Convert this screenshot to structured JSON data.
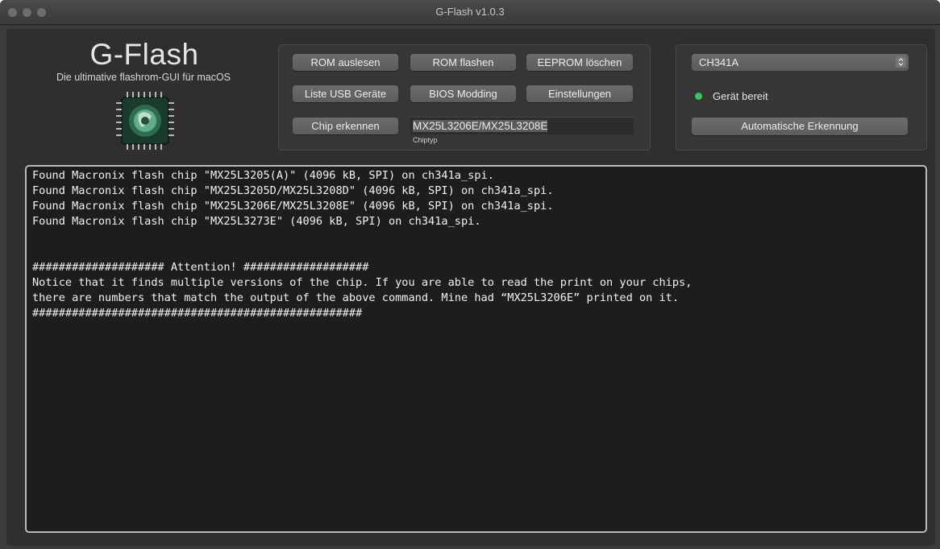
{
  "window": {
    "title": "G-Flash v1.0.3"
  },
  "brand": {
    "name": "G-Flash",
    "subtitle": "Die ultimative flashrom-GUI für macOS",
    "logo_icon": "chip-logo-icon"
  },
  "actions": {
    "read_rom": "ROM auslesen",
    "flash_rom": "ROM flashen",
    "erase_eeprom": "EEPROM löschen",
    "usb_list": "Liste USB Geräte",
    "bios_modding": "BIOS Modding",
    "settings": "Einstellungen",
    "detect_chip": "Chip erkennen"
  },
  "chip": {
    "value": "MX25L3206E/MX25L3208E",
    "label": "Chiptyp"
  },
  "device": {
    "selected": "CH341A",
    "status": "Gerät bereit",
    "status_color": "#35c759",
    "auto_detect": "Automatische Erkennung"
  },
  "console": {
    "lines": [
      "Found Macronix flash chip \"MX25L3205(A)\" (4096 kB, SPI) on ch341a_spi.",
      "Found Macronix flash chip \"MX25L3205D/MX25L3208D\" (4096 kB, SPI) on ch341a_spi.",
      "Found Macronix flash chip \"MX25L3206E/MX25L3208E\" (4096 kB, SPI) on ch341a_spi.",
      "Found Macronix flash chip \"MX25L3273E\" (4096 kB, SPI) on ch341a_spi.",
      "",
      "",
      "#################### Attention! ###################",
      "Notice that it finds multiple versions of the chip. If you are able to read the print on your chips,",
      "there are numbers that match the output of the above command. Mine had “MX25L3206E” printed on it.",
      "##################################################"
    ]
  }
}
